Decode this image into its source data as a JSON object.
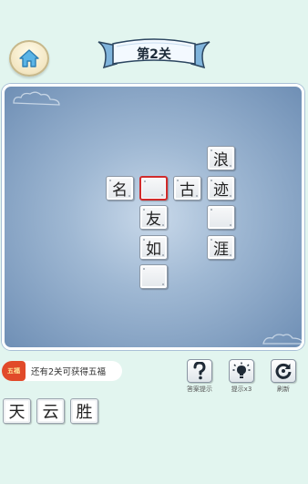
{
  "level": {
    "title": "第2关"
  },
  "board": {
    "cells": [
      {
        "row": 0,
        "col": 3,
        "char": "浪"
      },
      {
        "row": 1,
        "col": 0,
        "char": "名"
      },
      {
        "row": 1,
        "col": 1,
        "char": "",
        "selected": true
      },
      {
        "row": 1,
        "col": 2,
        "char": "古"
      },
      {
        "row": 1,
        "col": 3,
        "char": "迹"
      },
      {
        "row": 2,
        "col": 1,
        "char": "友"
      },
      {
        "row": 2,
        "col": 3,
        "char": ""
      },
      {
        "row": 3,
        "col": 1,
        "char": "如"
      },
      {
        "row": 3,
        "col": 3,
        "char": "涯"
      },
      {
        "row": 4,
        "col": 1,
        "char": ""
      }
    ]
  },
  "reward": {
    "icon_text": "五福",
    "text": "还有2关可获得五福"
  },
  "tools": [
    {
      "icon": "question-icon",
      "label": "答案提示"
    },
    {
      "icon": "lightbulb-icon",
      "label": "提示x3"
    },
    {
      "icon": "refresh-icon",
      "label": "刷新"
    }
  ],
  "candidates": [
    "天",
    "云",
    "胜"
  ],
  "colors": {
    "background": "#e2f5ef",
    "selected_border": "#d02b2b",
    "board": "#8faac8"
  }
}
